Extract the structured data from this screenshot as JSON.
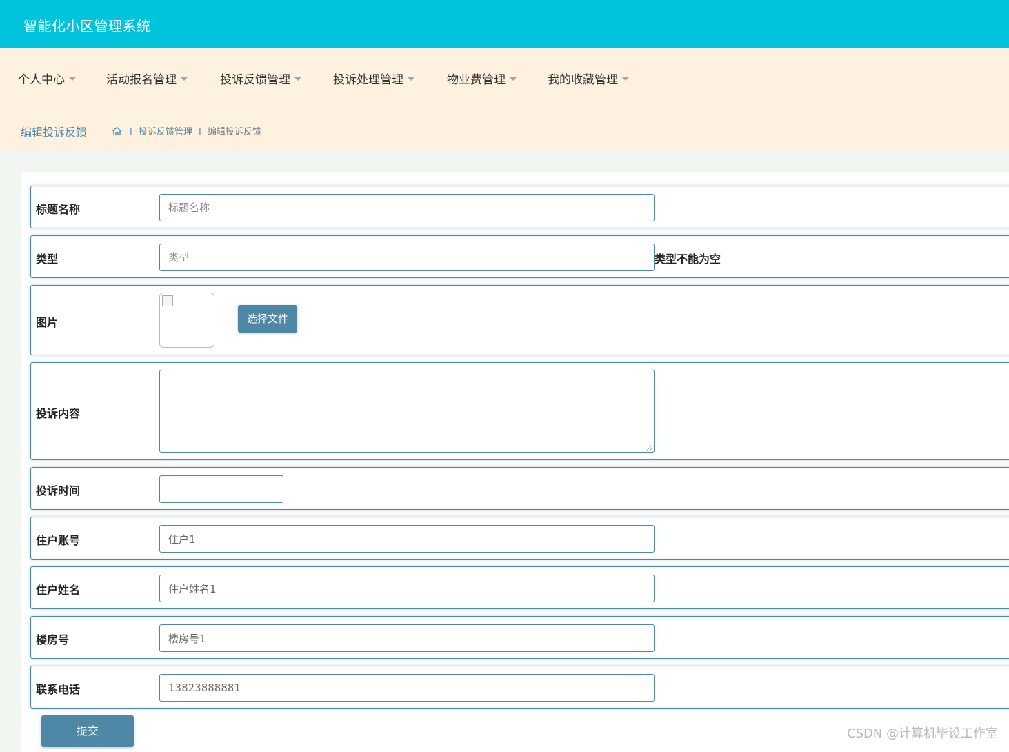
{
  "app": {
    "title": "智能化小区管理系统"
  },
  "nav": {
    "items": [
      {
        "label": "个人中心"
      },
      {
        "label": "活动报名管理"
      },
      {
        "label": "投诉反馈管理"
      },
      {
        "label": "投诉处理管理"
      },
      {
        "label": "物业费管理"
      },
      {
        "label": "我的收藏管理"
      }
    ]
  },
  "breadcrumb": {
    "page_title": "编辑投诉反馈",
    "sep": "l",
    "items": [
      "投诉反馈管理",
      "编辑投诉反馈"
    ]
  },
  "form": {
    "title": {
      "label": "标题名称",
      "placeholder": "标题名称",
      "value": ""
    },
    "type": {
      "label": "类型",
      "placeholder": "类型",
      "value": "",
      "error": "类型不能为空"
    },
    "image": {
      "label": "图片",
      "button": "选择文件"
    },
    "content": {
      "label": "投诉内容",
      "value": ""
    },
    "time": {
      "label": "投诉时间",
      "value": ""
    },
    "account": {
      "label": "住户账号",
      "value": "住户1"
    },
    "name": {
      "label": "住户姓名",
      "value": "住户姓名1"
    },
    "building": {
      "label": "楼房号",
      "value": "楼房号1"
    },
    "phone": {
      "label": "联系电话",
      "value": "13823888881"
    },
    "submit": "提交"
  },
  "watermark": "CSDN @计算机毕设工作室",
  "colors": {
    "topbar": "#00c3dc",
    "nav_bg": "#fff1df",
    "accent": "#4f87a6"
  }
}
